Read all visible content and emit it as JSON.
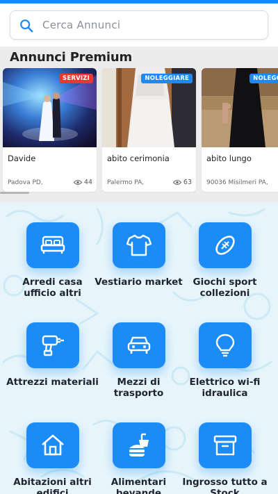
{
  "search": {
    "placeholder": "Cerca Annunci"
  },
  "premium": {
    "title": "Annunci Premium",
    "cards": [
      {
        "title": "Davide",
        "badge": "SERVIZI",
        "badge_color": "#e53935",
        "location": "Padova PD,",
        "views": "44"
      },
      {
        "title": "abito cerimonia",
        "badge": "NOLEGGIARE",
        "badge_color": "#1e88f5",
        "location": "Palermo PA,",
        "views": "63"
      },
      {
        "title": "abito lungo",
        "badge": "NOLEGGIA",
        "badge_color": "#1e88f5",
        "location": "90036 Misilmeri PA,",
        "views": ""
      }
    ]
  },
  "categories": [
    {
      "label": "Arredi casa ufficio altri",
      "icon": "bed-icon"
    },
    {
      "label": "Vestiario market",
      "icon": "shirt-icon"
    },
    {
      "label": "Giochi sport collezioni",
      "icon": "football-icon"
    },
    {
      "label": "Attrezzi materiali",
      "icon": "drill-icon"
    },
    {
      "label": "Mezzi di trasporto",
      "icon": "car-icon"
    },
    {
      "label": "Elettrico wi-fi idraulica",
      "icon": "lightbulb-icon"
    },
    {
      "label": "Abitazioni altri edifici",
      "icon": "house-icon"
    },
    {
      "label": "Alimentari bevande",
      "icon": "food-drink-icon"
    },
    {
      "label": "Ingrosso tutto a Stock",
      "icon": "archive-box-icon"
    }
  ],
  "colors": {
    "accent": "#1b8cf6",
    "topbar": "#1e88f5",
    "premium_bg": "#ececec",
    "category_bg": "#e7f5fb"
  }
}
